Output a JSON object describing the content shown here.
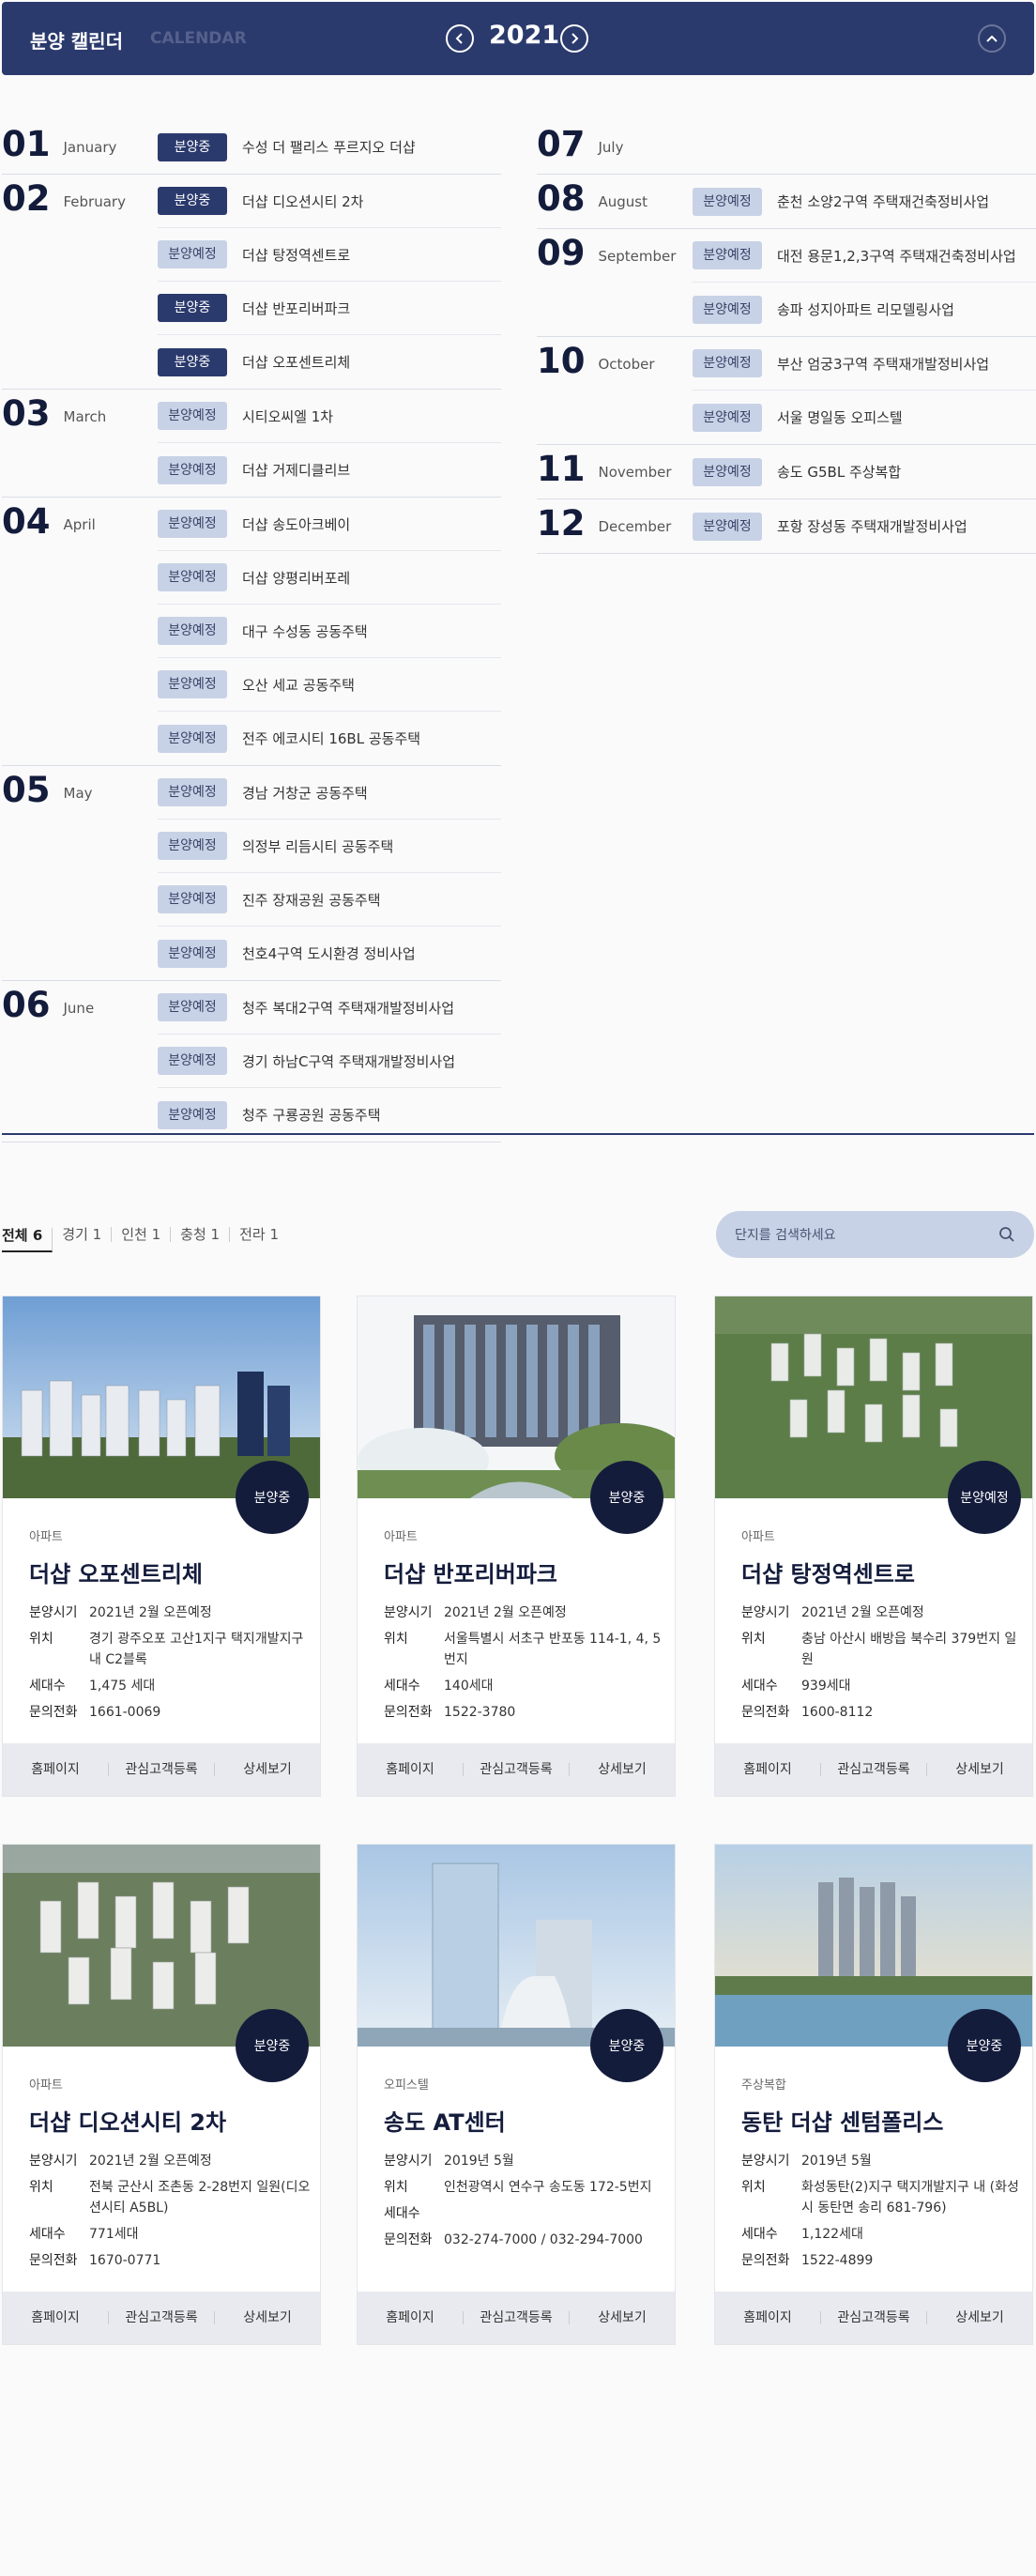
{
  "header": {
    "title": "분양 캘린더",
    "subtitle": "CALENDAR",
    "year": "2021",
    "prev_icon": "chevron-left-icon",
    "next_icon": "chevron-right-icon",
    "collapse_icon": "chevron-up-icon"
  },
  "calendar_left": [
    {
      "num": "01",
      "name": "January",
      "items": [
        {
          "status": "분양중",
          "title": "수성 더 팰리스 푸르지오 더샵"
        }
      ]
    },
    {
      "num": "02",
      "name": "February",
      "items": [
        {
          "status": "분양중",
          "title": "더샵 디오션시티 2차"
        },
        {
          "status": "분양예정",
          "title": "더샵 탕정역센트로"
        },
        {
          "status": "분양중",
          "title": "더샵 반포리버파크"
        },
        {
          "status": "분양중",
          "title": "더샵 오포센트리체"
        }
      ]
    },
    {
      "num": "03",
      "name": "March",
      "items": [
        {
          "status": "분양예정",
          "title": "시티오씨엘 1차"
        },
        {
          "status": "분양예정",
          "title": "더샵 거제디클리브"
        }
      ]
    },
    {
      "num": "04",
      "name": "April",
      "items": [
        {
          "status": "분양예정",
          "title": "더샵 송도아크베이"
        },
        {
          "status": "분양예정",
          "title": "더샵 양평리버포레"
        },
        {
          "status": "분양예정",
          "title": "대구 수성동 공동주택"
        },
        {
          "status": "분양예정",
          "title": "오산 세교 공동주택"
        },
        {
          "status": "분양예정",
          "title": "전주 에코시티 16BL 공동주택"
        }
      ]
    },
    {
      "num": "05",
      "name": "May",
      "items": [
        {
          "status": "분양예정",
          "title": "경남 거창군 공동주택"
        },
        {
          "status": "분양예정",
          "title": "의정부 리듬시티 공동주택"
        },
        {
          "status": "분양예정",
          "title": "진주 장재공원 공동주택"
        },
        {
          "status": "분양예정",
          "title": "천호4구역 도시환경 정비사업"
        }
      ]
    },
    {
      "num": "06",
      "name": "June",
      "items": [
        {
          "status": "분양예정",
          "title": "청주 복대2구역 주택재개발정비사업"
        },
        {
          "status": "분양예정",
          "title": "경기 하남C구역 주택재개발정비사업"
        },
        {
          "status": "분양예정",
          "title": "청주 구룡공원 공동주택"
        }
      ]
    }
  ],
  "calendar_right": [
    {
      "num": "07",
      "name": "July",
      "items": []
    },
    {
      "num": "08",
      "name": "August",
      "items": [
        {
          "status": "분양예정",
          "title": "춘천 소양2구역 주택재건축정비사업"
        }
      ]
    },
    {
      "num": "09",
      "name": "September",
      "items": [
        {
          "status": "분양예정",
          "title": "대전 용문1,2,3구역 주택재건축정비사업"
        },
        {
          "status": "분양예정",
          "title": "송파 성지아파트 리모델링사업"
        }
      ]
    },
    {
      "num": "10",
      "name": "October",
      "items": [
        {
          "status": "분양예정",
          "title": "부산 엄궁3구역 주택재개발정비사업"
        },
        {
          "status": "분양예정",
          "title": "서울 명일동 오피스텔"
        }
      ]
    },
    {
      "num": "11",
      "name": "November",
      "items": [
        {
          "status": "분양예정",
          "title": "송도 G5BL 주상복합"
        }
      ]
    },
    {
      "num": "12",
      "name": "December",
      "items": [
        {
          "status": "분양예정",
          "title": "포항 장성동 주택재개발정비사업"
        }
      ]
    }
  ],
  "filter": {
    "tabs": [
      {
        "label": "전체",
        "count": "6"
      },
      {
        "label": "경기",
        "count": "1"
      },
      {
        "label": "인천",
        "count": "1"
      },
      {
        "label": "충청",
        "count": "1"
      },
      {
        "label": "전라",
        "count": "1"
      }
    ],
    "search_placeholder": "단지를 검색하세요",
    "search_icon": "search-icon"
  },
  "labels": {
    "period": "분양시기",
    "location": "위치",
    "units": "세대수",
    "phone": "문의전화"
  },
  "card_links": [
    "홈페이지",
    "관심고객등록",
    "상세보기"
  ],
  "cards": [
    {
      "status": "분양중",
      "type": "아파트",
      "title": "더샵 오포센트리체",
      "period": "2021년 2월 오픈예정",
      "location": "경기 광주오포 고산1지구 택지개발지구 내 C2블록",
      "units": "1,475 세대",
      "phone": "1661-0069"
    },
    {
      "status": "분양중",
      "type": "아파트",
      "title": "더샵 반포리버파크",
      "period": "2021년 2월 오픈예정",
      "location": "서울특별시 서초구 반포동 114-1, 4, 5번지",
      "units": "140세대",
      "phone": "1522-3780"
    },
    {
      "status": "분양예정",
      "type": "아파트",
      "title": "더샵 탕정역센트로",
      "period": "2021년 2월 오픈예정",
      "location": "충남 아산시 배방읍 북수리 379번지 일원",
      "units": "939세대",
      "phone": "1600-8112"
    },
    {
      "status": "분양중",
      "type": "아파트",
      "title": "더샵 디오션시티 2차",
      "period": "2021년 2월 오픈예정",
      "location": "전북 군산시 조촌동 2-28번지 일원(디오션시티 A5BL)",
      "units": "771세대",
      "phone": "1670-0771"
    },
    {
      "status": "분양중",
      "type": "오피스텔",
      "title": "송도 AT센터",
      "period": "2019년 5월",
      "location": "인천광역시 연수구 송도동 172-5번지",
      "units": "",
      "phone": "032-274-7000 / 032-294-7000"
    },
    {
      "status": "분양중",
      "type": "주상복합",
      "title": "동탄 더샵 센텀폴리스",
      "period": "2019년 5월",
      "location": "화성동탄(2)지구 택지개발지구 내 (화성시 동탄면 송리 681-796)",
      "units": "1,122세대",
      "phone": "1522-4899"
    }
  ]
}
